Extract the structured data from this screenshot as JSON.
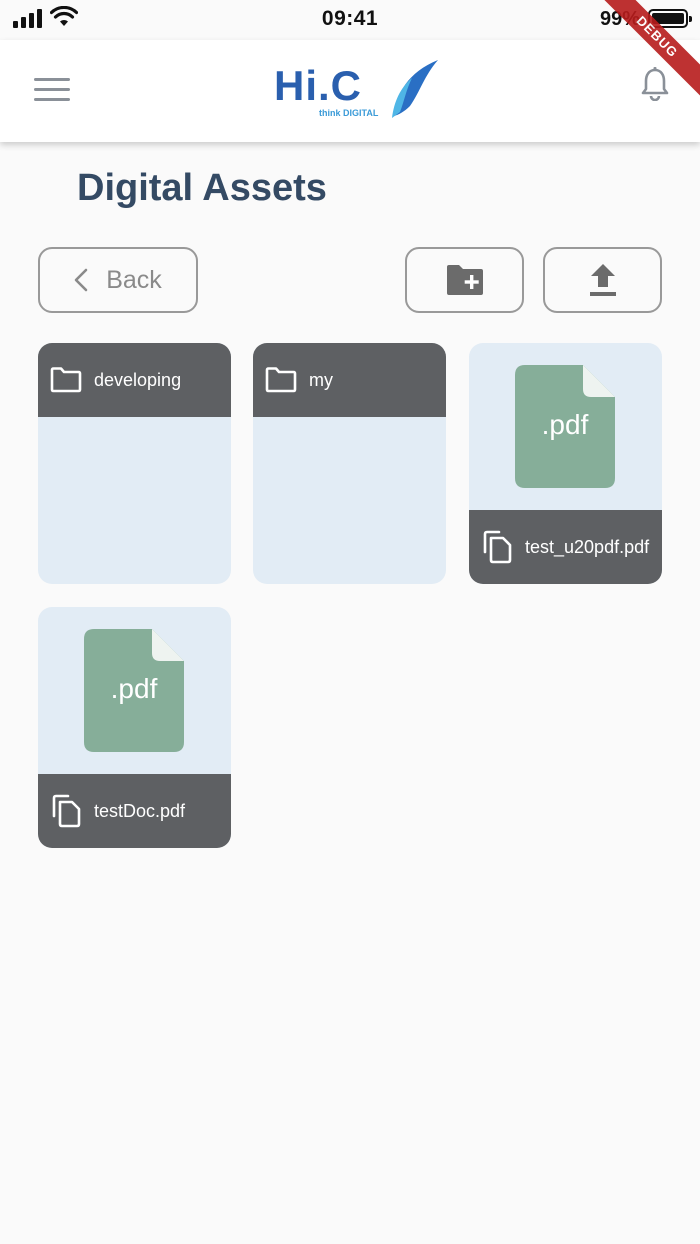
{
  "status_bar": {
    "time": "09:41",
    "battery": "99%"
  },
  "debug_banner": "DEBUG",
  "header": {
    "logo_text": "Hi.C",
    "logo_tagline": "think DIGITAL"
  },
  "page": {
    "title": "Digital Assets"
  },
  "toolbar": {
    "back_label": "Back"
  },
  "items": [
    {
      "type": "folder",
      "name": "developing"
    },
    {
      "type": "folder",
      "name": "my"
    },
    {
      "type": "file",
      "name": "test_u20pdf.pdf",
      "ext": ".pdf"
    },
    {
      "type": "file",
      "name": "testDoc.pdf",
      "ext": ".pdf"
    }
  ],
  "colors": {
    "card_background": "#e2ecf5",
    "card_bar": "#5e6063",
    "pdf_icon": "#86ae99",
    "title": "#344a64",
    "logo_blue": "#2a5fae"
  },
  "icons": [
    "menu-icon",
    "bell-icon",
    "chevron-left-icon",
    "new-folder-icon",
    "upload-icon",
    "folder-icon",
    "pdf-file-icon",
    "copy-file-icon"
  ]
}
